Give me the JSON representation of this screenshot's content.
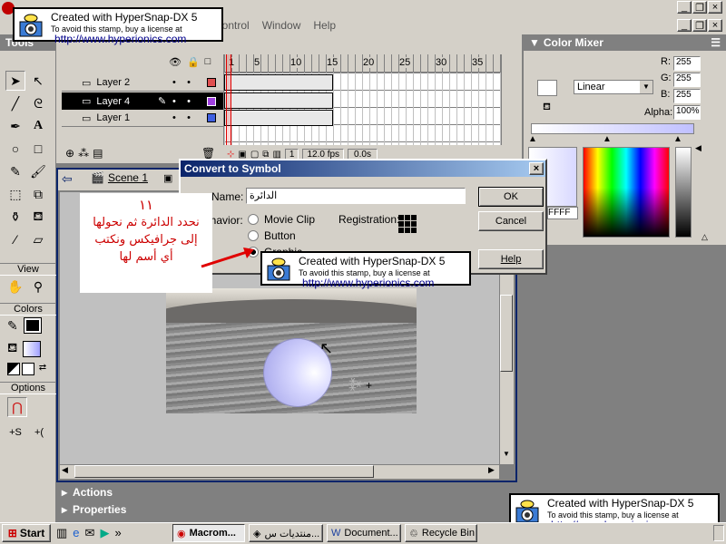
{
  "stamp": {
    "line1": "Created with HyperSnap-DX 5",
    "line2": "To avoid this stamp, buy a license at",
    "line3": "http://www.hyperionics.com"
  },
  "menubar": {
    "control": "Control",
    "window": "Window",
    "help": "Help"
  },
  "tools": {
    "title": "Tools",
    "view": "View",
    "colors": "Colors",
    "options": "Options"
  },
  "timeline": {
    "frame_numbers": [
      "1",
      "5",
      "10",
      "15",
      "20",
      "25",
      "30",
      "35"
    ],
    "layers": [
      "Layer 2",
      "Layer 4",
      "Layer 1"
    ],
    "selected_layer": "Layer 4",
    "current_frame": "1",
    "fps": "12.0 fps",
    "time": "0.0s"
  },
  "scene": {
    "label": "Scene 1"
  },
  "color_mixer": {
    "title": "Color Mixer",
    "fill_type": "Linear",
    "r_label": "R:",
    "g_label": "G:",
    "b_label": "B:",
    "alpha_label": "Alpha:",
    "r": "255",
    "g": "255",
    "b": "255",
    "alpha": "100%",
    "hex": "FFFF"
  },
  "dialog": {
    "title": "Convert to Symbol",
    "name_label": "Name:",
    "name_value": "الدائرة",
    "behavior_label": "Behavior:",
    "options": [
      "Movie Clip",
      "Button",
      "Graphic"
    ],
    "selected_option": "Graphic",
    "registration_label": "Registration:",
    "ok": "OK",
    "cancel": "Cancel",
    "help": "Help"
  },
  "annotation": {
    "number": "١١",
    "text_line1": "نحدد الدائرة ثم نحولها",
    "text_line2": "إلى جرافيكس ونكتب",
    "text_line3": "أي أسم لها"
  },
  "panels": {
    "actions": "Actions",
    "properties": "Properties"
  },
  "taskbar": {
    "start": "Start",
    "items": [
      "Macrom...",
      "منتديات س...",
      "Document...",
      "Recycle Bin"
    ],
    "chevron": "»"
  },
  "colors": {
    "dialog_title_bg": "#0a246a",
    "stage_bg": "#c0c0c0",
    "annotation_text": "#cc0000",
    "arrow": "#e00000",
    "selected_layer_bg": "#000000"
  }
}
